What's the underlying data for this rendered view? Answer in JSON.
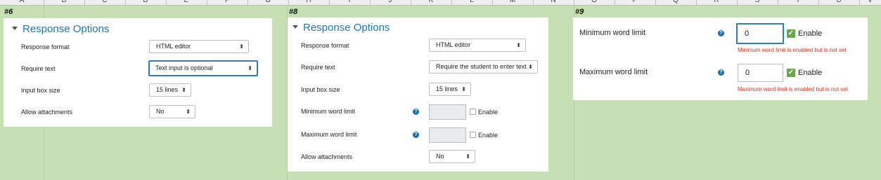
{
  "sheet": {
    "columns": [
      "A",
      "B",
      "C",
      "D",
      "E",
      "F",
      "G",
      "H",
      "I",
      "J",
      "K",
      "L",
      "M",
      "N",
      "O",
      "P",
      "Q",
      "R",
      "S",
      "T",
      "U",
      "V"
    ]
  },
  "panel6": {
    "section_label": "#6",
    "title": "Response Options",
    "fields": {
      "response_format": {
        "label": "Response format",
        "value": "HTML editor"
      },
      "require_text": {
        "label": "Require text",
        "value": "Text input is optional"
      },
      "input_box_size": {
        "label": "Input box size",
        "value": "15 lines"
      },
      "allow_attachments": {
        "label": "Allow attachments",
        "value": "No"
      }
    }
  },
  "panel8": {
    "section_label": "#8",
    "title": "Response Options",
    "fields": {
      "response_format": {
        "label": "Response format",
        "value": "HTML editor"
      },
      "require_text": {
        "label": "Require text",
        "value": "Require the student to enter text"
      },
      "input_box_size": {
        "label": "Input box size",
        "value": "15 lines"
      },
      "min_word_limit": {
        "label": "Minimum word limit",
        "value": "",
        "enable_label": "Enable",
        "enabled": false
      },
      "max_word_limit": {
        "label": "Maximum word limit",
        "value": "",
        "enable_label": "Enable",
        "enabled": false
      },
      "allow_attachments": {
        "label": "Allow attachments",
        "value": "No"
      }
    }
  },
  "panel9": {
    "section_label": "#9",
    "fields": {
      "min_word_limit": {
        "label": "Minimum word limit",
        "value": "0",
        "enable_label": "Enable",
        "enabled": true,
        "error": "Minimum word limit is enabled but is not set"
      },
      "max_word_limit": {
        "label": "Maximum word limit",
        "value": "0",
        "enable_label": "Enable",
        "enabled": true,
        "error": "Maximum word limit is enabled but is not set"
      }
    }
  },
  "icons": {
    "help": "?",
    "select_arrow": "⬍",
    "check": "✓"
  },
  "colors": {
    "background": "#c6e0b4",
    "title": "#1f77b4",
    "error": "#d0331f",
    "focus": "#2f7bbf",
    "checkbox_on": "#6aa84f"
  }
}
